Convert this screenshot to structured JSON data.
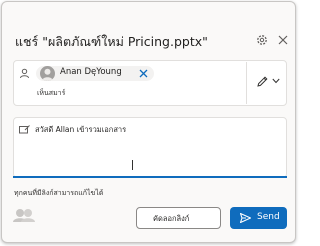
{
  "dialog": {
    "title": "แชร์ \"ผลิตภัณฑ์ใหม่ Pricing.pptx\"",
    "icons": {
      "settings": "gear-icon",
      "close": "close-icon"
    }
  },
  "recipients": {
    "chip_name": "Anan DeYoung",
    "permission": "เห็นสมาร์"
  },
  "message": {
    "text": "สวัสดี Allan เข้ารวมเอกสาร"
  },
  "link_settings": {
    "text": "ทุกคนที่มีลิงก์สามารถแก้ไขได้"
  },
  "buttons": {
    "copy_link": "คัดลอกลิงก์",
    "send": "Send"
  },
  "colors": {
    "accent": "#0f6cbd",
    "border": "#e1dfdd",
    "dialog_bg": "#faf9f8"
  }
}
